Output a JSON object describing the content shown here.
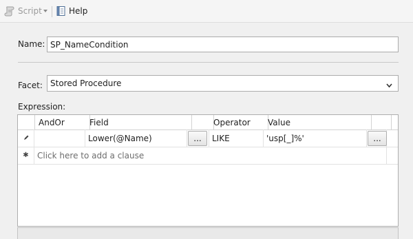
{
  "toolbar": {
    "script_label": "Script",
    "help_label": "Help"
  },
  "name": {
    "label": "Name:",
    "value": "SP_NameCondition"
  },
  "facet": {
    "label": "Facet:",
    "selected": "Stored Procedure"
  },
  "expression": {
    "label": "Expression:",
    "columns": [
      "AndOr",
      "Field",
      "Operator",
      "Value"
    ],
    "rows": [
      {
        "andor": "",
        "field": "Lower(@Name)",
        "operator": "LIKE",
        "value": "'usp[_]%'"
      }
    ],
    "new_row_placeholder": "Click here to add a clause",
    "ellipsis": "..."
  }
}
